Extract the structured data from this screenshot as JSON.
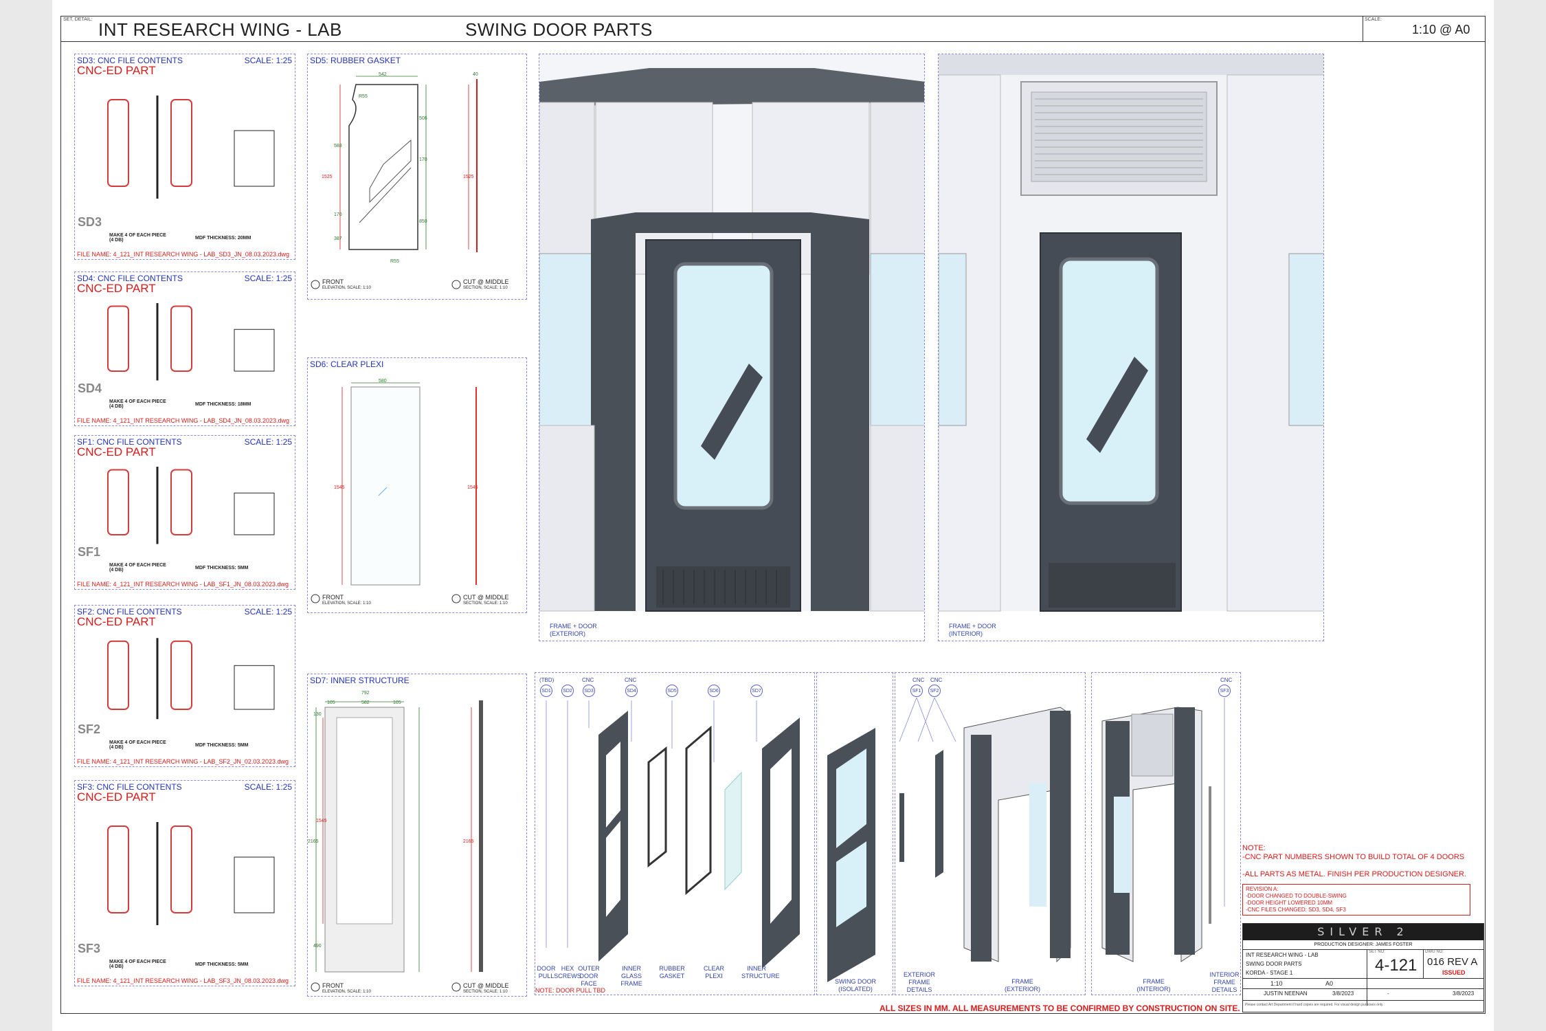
{
  "header": {
    "set_detail_label": "SET, DETAIL:",
    "set_title": "INT RESEARCH WING - LAB",
    "drawing_title": "SWING DOOR PARTS",
    "scale_label": "SCALE:",
    "scale_value": "1:10 @ A0"
  },
  "cnc_panels": [
    {
      "title": "SD3: CNC FILE CONTENTS",
      "scale": "SCALE: 1:25",
      "subtitle": "CNC-ED PART",
      "code": "SD3",
      "make": "MAKE 4 OF EACH PIECE (4 DB)",
      "mdf": "MDF THICKNESS: 20MM",
      "file": "FILE NAME: 4_121_INT RESEARCH WING - LAB_SD3_JN_08.03.2023.dwg",
      "color": "#d63a3a"
    },
    {
      "title": "SD4: CNC FILE CONTENTS",
      "scale": "SCALE: 1:25",
      "subtitle": "CNC-ED PART",
      "code": "SD4",
      "make": "MAKE 4 OF EACH PIECE (4 DB)",
      "mdf": "MDF THICKNESS: 18MM",
      "file": "FILE NAME: 4_121_INT RESEARCH WING - LAB_SD4_JN_08.03.2023.dwg",
      "color": "#d63a3a"
    },
    {
      "title": "SF1: CNC FILE CONTENTS",
      "scale": "SCALE: 1:25",
      "subtitle": "CNC-ED PART",
      "code": "SF1",
      "make": "MAKE 4 OF EACH PIECE (4 DB)",
      "mdf": "MDF THICKNESS: 5MM",
      "file": "FILE NAME: 4_121_INT RESEARCH WING - LAB_SF1_JN_08.03.2023.dwg",
      "color": "#d63a3a"
    },
    {
      "title": "SF2: CNC FILE CONTENTS",
      "scale": "SCALE: 1:25",
      "subtitle": "CNC-ED PART",
      "code": "SF2",
      "make": "MAKE 4 OF EACH PIECE (4 DB)",
      "mdf": "MDF THICKNESS: 5MM",
      "file": "FILE NAME: 4_121_INT RESEARCH WING - LAB_SF2_JN_02.03.2023.dwg",
      "color": "#d63a3a"
    },
    {
      "title": "SF3: CNC FILE CONTENTS",
      "scale": "SCALE: 1:25",
      "subtitle": "CNC-ED PART",
      "code": "SF3",
      "make": "MAKE 4 OF EACH PIECE (4 DB)",
      "mdf": "MDF THICKNESS: 5MM",
      "file": "FILE NAME: 4_121_INT RESEARCH WING - LAB_SF3_JN_08.03.2023.dwg",
      "color": "#d63a3a"
    }
  ],
  "sd5": {
    "title": "SD5: RUBBER GASKET",
    "dims": [
      "542",
      "R55",
      "588",
      "1525",
      "170",
      "387",
      "R55",
      "506",
      "170",
      "850",
      "1525",
      "40"
    ],
    "front": "FRONT",
    "front_sub": "ELEVATION, SCALE: 1:10",
    "cut": "CUT @ MIDDLE",
    "cut_sub": "SECTION, SCALE: 1:10"
  },
  "sd6": {
    "title": "SD6: CLEAR PLEXI",
    "dims": [
      "580",
      "1545",
      "1545"
    ],
    "front": "FRONT",
    "front_sub": "ELEVATION, SCALE: 1:10",
    "cut": "CUT @ MIDDLE",
    "cut_sub": "SECTION, SCALE: 1:10"
  },
  "sd7": {
    "title": "SD7: INNER STRUCTURE",
    "dims": [
      "792",
      "105",
      "582",
      "105",
      "130",
      "1545",
      "2165",
      "490",
      "2165"
    ],
    "front": "FRONT",
    "front_sub": "ELEVATION, SCALE: 1:10",
    "cut": "CUT @ MIDDLE",
    "cut_sub": "SECTION, SCALE: 1:10"
  },
  "renders": {
    "exterior_caption": "FRAME + DOOR (EXTERIOR)",
    "interior_caption": "FRAME + DOOR (INTERIOR)"
  },
  "exploded": {
    "top_tags": [
      "(TBD)",
      "",
      "CNC",
      "CNC",
      "",
      "",
      ""
    ],
    "balloons": [
      "SD1",
      "SD2",
      "SD3",
      "SD4",
      "SD5",
      "SD6",
      "SD7"
    ],
    "captions": [
      "DOOR PULL",
      "HEX SCREWS",
      "OUTER DOOR FACE",
      "INNER GLASS FRAME",
      "RUBBER GASKET",
      "CLEAR PLEXI",
      "INNER STRUCTURE"
    ],
    "note": "NOTE: DOOR PULL TBD",
    "isolated_caption": "SWING DOOR (ISOLATED)"
  },
  "frame_exploded": {
    "tags": [
      "CNC",
      "CNC"
    ],
    "balloons": [
      "SF1",
      "SF2"
    ],
    "captions": [
      "EXTERIOR FRAME DETAILS",
      "FRAME (EXTERIOR)"
    ]
  },
  "frame_interior": {
    "tag": "CNC",
    "balloon": "SF3",
    "captions": [
      "FRAME (INTERIOR)",
      "INTERIOR FRAME DETAILS"
    ]
  },
  "notes": {
    "heading": "NOTE:",
    "line1": "-CNC PART NUMBERS SHOWN TO BUILD TOTAL OF 4 DOORS",
    "line2": "-ALL PARTS AS METAL. FINISH PER PRODUCTION DESIGNER.",
    "revision_title": "REVISION A:",
    "revision_lines": [
      "-DOOR CHANGED TO DOUBLE-SWING",
      "-DOOR HEIGHT LOWERED 10MM",
      "-CNC FILES CHANGED: SD3, SD4, SF3"
    ]
  },
  "bottom_note": "ALL SIZES IN MM. ALL MEASUREMENTS TO BE CONFIRMED BY CONSTRUCTION ON SITE.",
  "title_block": {
    "logo": "SILVER 2",
    "production_designer": "PRODUCTION DESIGNER: JAMES FOSTER",
    "set": "INT RESEARCH WING - LAB",
    "detail": "SWING DOOR PARTS",
    "location": "KORDA - STAGE 1",
    "set_no_label": "SET NO:",
    "set_no": "4-121",
    "dwg_no_label": "DWG NO:",
    "dwg_no": "016 REV A",
    "status": "ISSUED",
    "scale": "1:10",
    "print_size": "A0",
    "drawn_by": "JUSTIN NEENAN",
    "date_drawn": "3/8/2023",
    "revision": "-",
    "date_issued": "3/8/2023",
    "footer": "Please contact Art Department if hard copies are required. For visual design purposes only."
  },
  "colors": {
    "accent_blue": "#2233bb",
    "red": "#d81b1b",
    "door_dark": "#4a5058",
    "glass": "#d8f0f8",
    "wall": "#eef0f5"
  }
}
